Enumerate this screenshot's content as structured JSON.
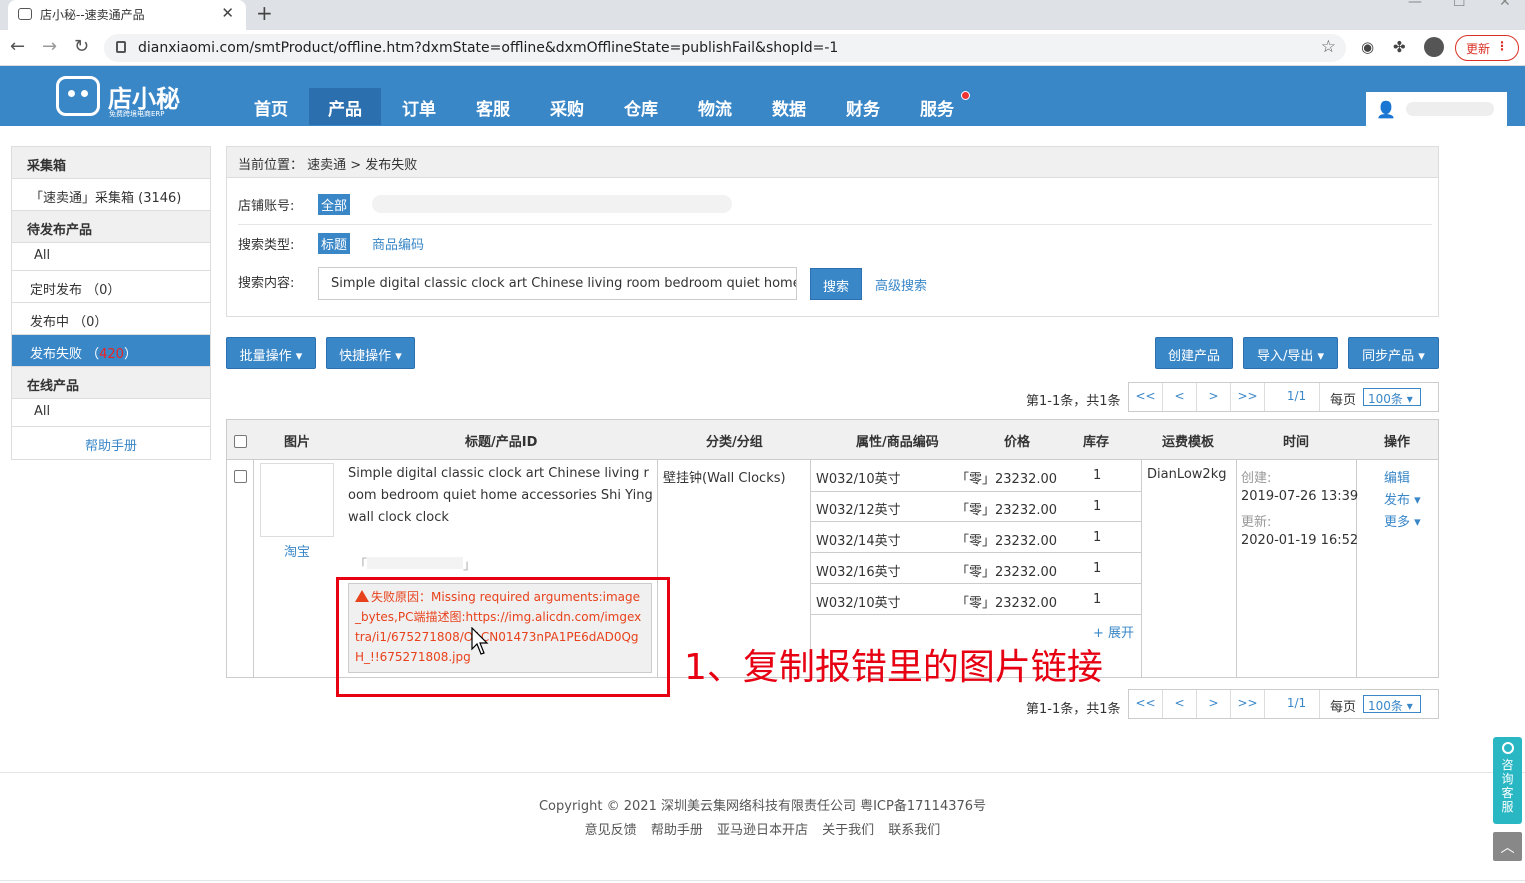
{
  "browser": {
    "tab_title": "店小秘--速卖通产品",
    "url": "dianxiaomi.com/smtProduct/offline.htm?dxmState=offline&dxmOfflineState=publishFail&shopId=-1",
    "update_label": "更新"
  },
  "header": {
    "logo_text": "店小秘",
    "logo_sub": "免费跨境电商ERP",
    "nav": [
      "首页",
      "产品",
      "订单",
      "客服",
      "采购",
      "仓库",
      "物流",
      "数据",
      "财务",
      "服务"
    ],
    "active_nav": "产品"
  },
  "sidebar": {
    "sections": [
      {
        "title": "采集箱",
        "items": [
          "「速卖通」采集箱 (3146)"
        ]
      },
      {
        "title": "待发布产品",
        "items": [
          "All",
          "定时发布 （0）",
          "发布中 （0）",
          "发布失败 （"
        ]
      },
      {
        "title": "在线产品",
        "items": [
          "All"
        ]
      }
    ],
    "fail_count": "420",
    "fail_suffix": "）",
    "help": "帮助手册"
  },
  "search": {
    "breadcrumb": "当前位置： 速卖通 > 发布失败",
    "shop_label": "店铺账号:",
    "shop_all": "全部",
    "type_label": "搜索类型:",
    "type_title": "标题",
    "type_code": "商品编码",
    "content_label": "搜索内容:",
    "content_value": "Simple digital classic clock art Chinese living room bedroom quiet home accessories Shi Ying wall clock clock",
    "search_btn": "搜索",
    "advanced": "高级搜索"
  },
  "toolbar": {
    "batch": "批量操作 ▾",
    "quick": "快捷操作 ▾",
    "create": "创建产品",
    "import_export": "导入/导出 ▾",
    "sync": "同步产品 ▾"
  },
  "pager": {
    "info": "第1-1条，共1条",
    "first": "<<",
    "prev": "<",
    "next": ">",
    "last": ">>",
    "page": "1/1",
    "per_page_label": "每页",
    "per_page": "100条 ▾"
  },
  "table": {
    "headers": [
      "图片",
      "标题/产品ID",
      "分类/分组",
      "属性/商品编码",
      "价格",
      "库存",
      "运费模板",
      "时间",
      "操作"
    ],
    "row": {
      "source": "淘宝",
      "title": "Simple digital classic clock art Chinese living room bedroom quiet home accessories Shi Ying wall clock clock",
      "id_prefix": "「",
      "id_suffix": "」",
      "category": "壁挂钟(Wall Clocks)",
      "variants": [
        {
          "attr": "W032/10英寸",
          "price": "「零」23232.00",
          "stock": "1"
        },
        {
          "attr": "W032/12英寸",
          "price": "「零」23232.00",
          "stock": "1"
        },
        {
          "attr": "W032/14英寸",
          "price": "「零」23232.00",
          "stock": "1"
        },
        {
          "attr": "W032/16英寸",
          "price": "「零」23232.00",
          "stock": "1"
        },
        {
          "attr": "W032/10英寸",
          "price": "「零」23232.00",
          "stock": "1"
        }
      ],
      "expand": "+ 展开",
      "shipping": "DianLow2kg",
      "created_label": "创建:",
      "created": "2019-07-26 13:39",
      "updated_label": "更新:",
      "updated": "2020-01-19 16:52",
      "actions": [
        "编辑",
        "发布 ▾",
        "更多 ▾"
      ],
      "fail_reason": "失败原因：Missing required arguments:image_bytes,PC端描述图:https://img.alicdn.com/imgextra/i1/675271808/O1CN01473nPA1PE6dAD0QgH_!!675271808.jpg"
    }
  },
  "annotation": "1、复制报错里的图片链接",
  "footer": {
    "copyright": "Copyright ©  2021 深圳美云集网络科技有限责任公司  粤ICP备17114376号",
    "links": [
      "意见反馈",
      "帮助手册",
      "亚马逊日本开店",
      "关于我们",
      "联系我们"
    ]
  },
  "float": {
    "consult": "咨询客服",
    "top": "︿"
  }
}
